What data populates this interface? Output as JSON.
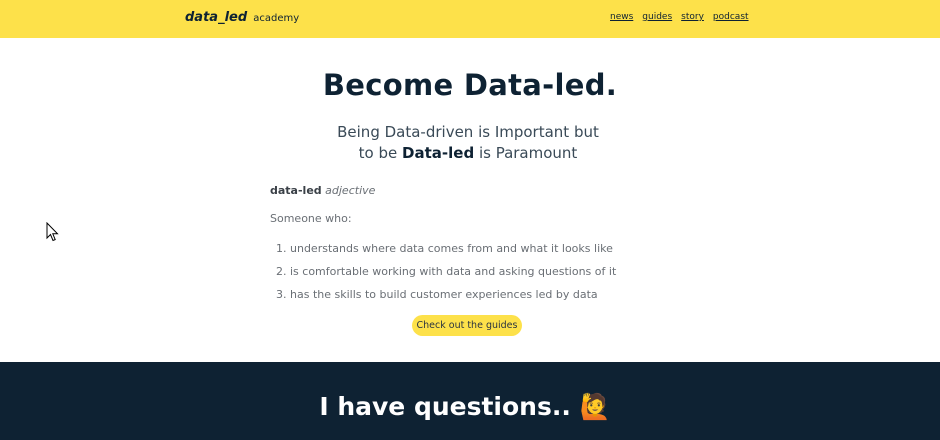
{
  "header": {
    "brand_bold": "data_led",
    "brand_light": "academy",
    "nav": [
      "news",
      "guides",
      "story",
      "podcast"
    ]
  },
  "hero": {
    "title": "Become Data-led.",
    "subtitle_line1": "Being Data-driven is Important but",
    "subtitle_line2_pre": "to be ",
    "subtitle_line2_bold": "Data-led",
    "subtitle_line2_post": " is Paramount"
  },
  "definition": {
    "term": "data-led",
    "part_of_speech": "adjective",
    "intro": "Someone who:",
    "items": [
      "understands where data comes from and what it looks like",
      "is comfortable working with data and asking questions of it",
      "has the skills to build customer experiences led by data"
    ]
  },
  "cta": {
    "label": "Check out the guides"
  },
  "questions": {
    "title": "I have questions.. 🙋"
  },
  "colors": {
    "accent": "#fde14a",
    "dark": "#0e2233"
  }
}
